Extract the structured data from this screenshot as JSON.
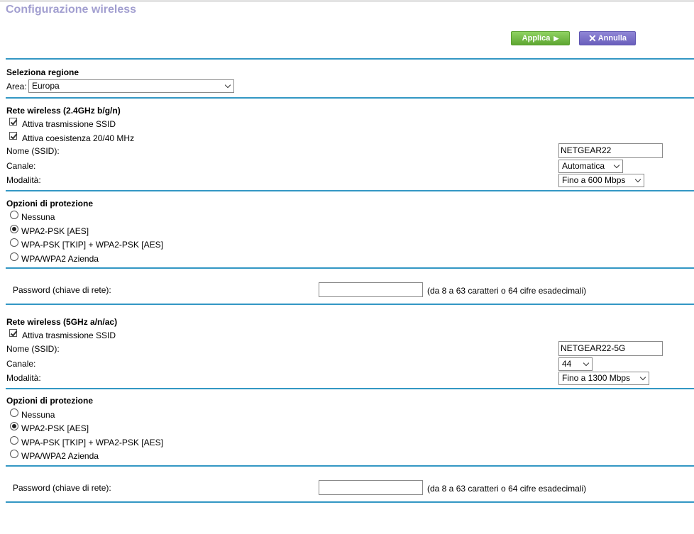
{
  "page": {
    "title": "Configurazione wireless"
  },
  "toolbar": {
    "apply_label": "Applica",
    "cancel_label": "Annulla"
  },
  "region": {
    "heading": "Seleziona regione",
    "area_label": "Area:",
    "area_value": "Europa"
  },
  "wifi24": {
    "heading": "Rete wireless (2.4GHz b/g/n)",
    "ssid_broadcast_label": "Attiva trasmissione SSID",
    "coexistence_label": "Attiva coesistenza 20/40 MHz",
    "ssid_label": "Nome (SSID):",
    "ssid_value": "NETGEAR22",
    "channel_label": "Canale:",
    "channel_value": "Automatica",
    "mode_label": "Modalità:",
    "mode_value": "Fino a 600 Mbps",
    "security": {
      "heading": "Opzioni di protezione",
      "options": [
        "Nessuna",
        "WPA2-PSK [AES]",
        "WPA-PSK [TKIP] + WPA2-PSK [AES]",
        "WPA/WPA2 Azienda"
      ],
      "selected": "WPA2-PSK [AES]"
    },
    "password_label": "Password (chiave di rete):",
    "password_hint": "(da 8 a 63 caratteri o 64 cifre esadecimali)"
  },
  "wifi5": {
    "heading": "Rete wireless (5GHz a/n/ac)",
    "ssid_broadcast_label": "Attiva trasmissione SSID",
    "ssid_label": "Nome (SSID):",
    "ssid_value": "NETGEAR22-5G",
    "channel_label": "Canale:",
    "channel_value": "44",
    "mode_label": "Modalità:",
    "mode_value": "Fino a 1300 Mbps",
    "security": {
      "heading": "Opzioni di protezione",
      "options": [
        "Nessuna",
        "WPA2-PSK [AES]",
        "WPA-PSK [TKIP] + WPA2-PSK [AES]",
        "WPA/WPA2 Azienda"
      ],
      "selected": "WPA2-PSK [AES]"
    },
    "password_label": "Password (chiave di rete):",
    "password_hint": "(da 8 a 63 caratteri o 64 cifre esadecimali)"
  },
  "icons": {
    "apply": "play-arrow-icon",
    "cancel": "close-icon",
    "dropdown": "chevron-down-icon",
    "checkbox": "checkmark-icon"
  },
  "colors": {
    "title": "#a29fd0",
    "apply_button": "#6db33f",
    "cancel_button": "#7366c6",
    "divider": "#3397c4"
  }
}
